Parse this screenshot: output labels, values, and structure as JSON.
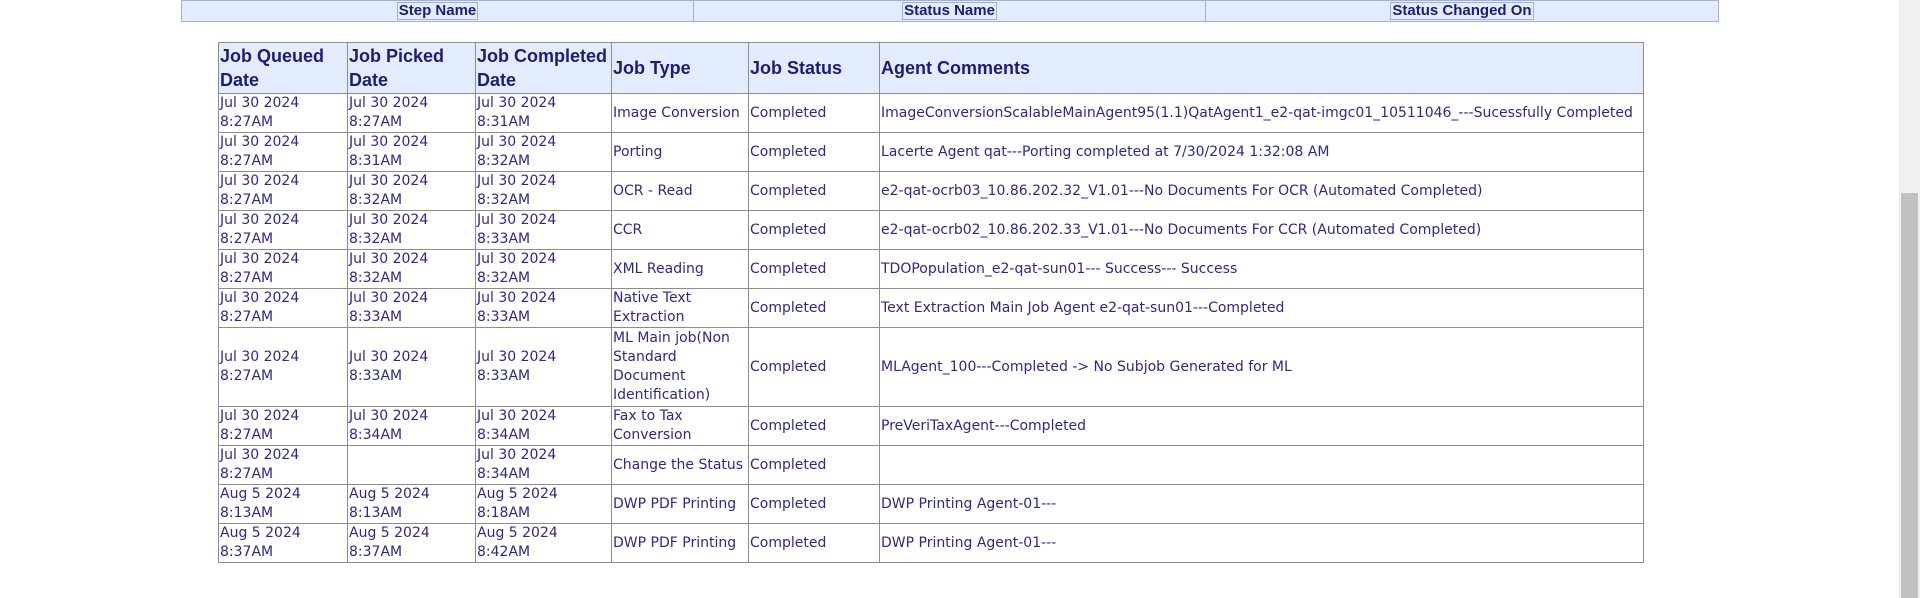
{
  "status_header": {
    "columns": [
      "Step Name",
      "Status Name",
      "Status Changed On"
    ]
  },
  "jobs_table": {
    "headers": {
      "queued": "Job Queued Date",
      "picked": "Job Picked Date",
      "completed": "Job Completed Date",
      "type": "Job Type",
      "status": "Job Status",
      "comments": "Agent Comments"
    },
    "rows": [
      {
        "queued": [
          "Jul 30 2024",
          "8:27AM"
        ],
        "picked": [
          "Jul 30 2024",
          "8:27AM"
        ],
        "completed": [
          "Jul 30 2024",
          "8:31AM"
        ],
        "type": "Image Conversion",
        "status": "Completed",
        "comments": "ImageConversionScalableMainAgent95(1.1)QatAgent1_e2-qat-imgc01_10511046_---Sucessfully Completed"
      },
      {
        "queued": [
          "Jul 30 2024",
          "8:27AM"
        ],
        "picked": [
          "Jul 30 2024",
          "8:31AM"
        ],
        "completed": [
          "Jul 30 2024",
          "8:32AM"
        ],
        "type": "Porting",
        "status": "Completed",
        "comments": "Lacerte Agent qat---Porting completed at 7/30/2024 1:32:08 AM"
      },
      {
        "queued": [
          "Jul 30 2024",
          "8:27AM"
        ],
        "picked": [
          "Jul 30 2024",
          "8:32AM"
        ],
        "completed": [
          "Jul 30 2024",
          "8:32AM"
        ],
        "type": "OCR - Read",
        "status": "Completed",
        "comments": "e2-qat-ocrb03_10.86.202.32_V1.01---No Documents For OCR (Automated Completed)"
      },
      {
        "queued": [
          "Jul 30 2024",
          "8:27AM"
        ],
        "picked": [
          "Jul 30 2024",
          "8:32AM"
        ],
        "completed": [
          "Jul 30 2024",
          "8:33AM"
        ],
        "type": "CCR",
        "status": "Completed",
        "comments": "e2-qat-ocrb02_10.86.202.33_V1.01---No Documents For CCR (Automated Completed)"
      },
      {
        "queued": [
          "Jul 30 2024",
          "8:27AM"
        ],
        "picked": [
          "Jul 30 2024",
          "8:32AM"
        ],
        "completed": [
          "Jul 30 2024",
          "8:32AM"
        ],
        "type": "XML Reading",
        "status": "Completed",
        "comments": "TDOPopulation_e2-qat-sun01--- Success--- Success"
      },
      {
        "queued": [
          "Jul 30 2024",
          "8:27AM"
        ],
        "picked": [
          "Jul 30 2024",
          "8:33AM"
        ],
        "completed": [
          "Jul 30 2024",
          "8:33AM"
        ],
        "type": "Native Text Extraction",
        "status": "Completed",
        "comments": "Text Extraction Main Job Agent e2-qat-sun01---Completed"
      },
      {
        "queued": [
          "Jul 30 2024",
          "8:27AM"
        ],
        "picked": [
          "Jul 30 2024",
          "8:33AM"
        ],
        "completed": [
          "Jul 30 2024",
          "8:33AM"
        ],
        "type": "ML Main job(Non Standard Document Identification)",
        "status": "Completed",
        "comments": "MLAgent_100---Completed -> No Subjob Generated for ML"
      },
      {
        "queued": [
          "Jul 30 2024",
          "8:27AM"
        ],
        "picked": [
          "Jul 30 2024",
          "8:34AM"
        ],
        "completed": [
          "Jul 30 2024",
          "8:34AM"
        ],
        "type": "Fax to Tax Conversion",
        "status": "Completed",
        "comments": "PreVeriTaxAgent---Completed"
      },
      {
        "queued": [
          "Jul 30 2024",
          "8:27AM"
        ],
        "picked": [
          "",
          ""
        ],
        "completed": [
          "Jul 30 2024",
          "8:34AM"
        ],
        "type": "Change the Status",
        "status": "Completed",
        "comments": ""
      },
      {
        "queued": [
          "Aug 5 2024",
          "8:13AM"
        ],
        "picked": [
          "Aug 5 2024",
          "8:13AM"
        ],
        "completed": [
          "Aug 5 2024",
          "8:18AM"
        ],
        "type": "DWP PDF Printing",
        "status": "Completed",
        "comments": "DWP Printing Agent-01---"
      },
      {
        "queued": [
          "Aug 5 2024",
          "8:37AM"
        ],
        "picked": [
          "Aug 5 2024",
          "8:37AM"
        ],
        "completed": [
          "Aug 5 2024",
          "8:42AM"
        ],
        "type": "DWP PDF Printing",
        "status": "Completed",
        "comments": "DWP Printing Agent-01---"
      }
    ]
  },
  "colors": {
    "header_bg": "#e3ecfc",
    "header_text": "#1c1c7a",
    "cell_text": "#2a2a8c",
    "border": "#8d8d8d"
  }
}
